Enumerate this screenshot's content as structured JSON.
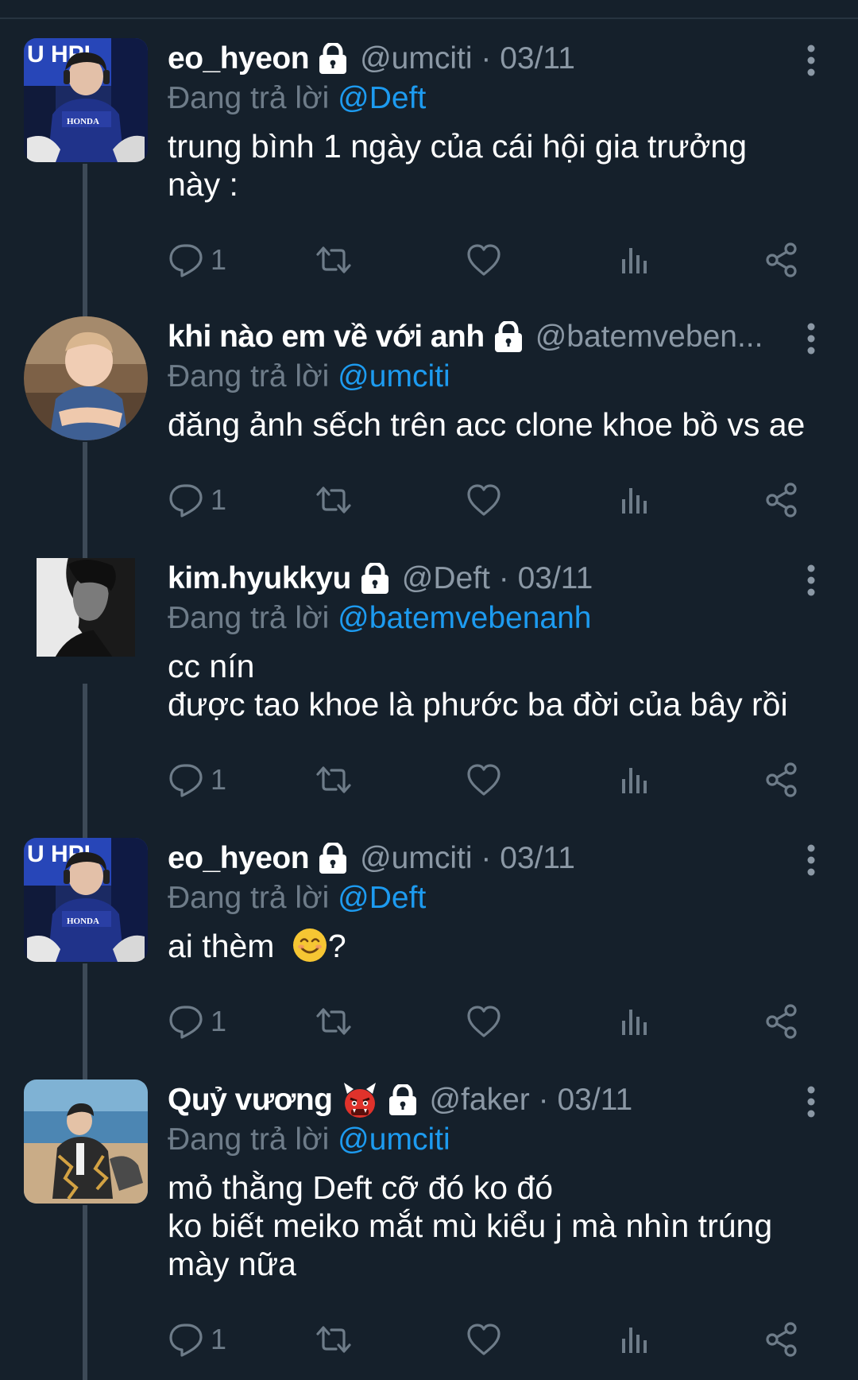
{
  "reply_prefix": "Đang trả lời",
  "tweets": [
    {
      "name": "eo_hyeon",
      "handle": "@umciti",
      "sep": "·",
      "date": "03/11",
      "reply_to": "@Deft",
      "lines": [
        "trung bình 1 ngày của cái hội gia trưởng",
        "này :"
      ],
      "reply_count": "1"
    },
    {
      "name": "khi nào em về với anh",
      "handle": "@batemveben...",
      "reply_to": "@umciti",
      "lines": [
        "đăng ảnh sếch trên acc clone khoe bồ vs ae"
      ],
      "reply_count": "1"
    },
    {
      "name": "kim.hyukkyu",
      "handle": "@Deft",
      "sep": "·",
      "date": "03/11",
      "reply_to": "@batemvebenanh",
      "lines": [
        "cc nín",
        "được tao khoe là phước ba đời của bây rồi"
      ],
      "reply_count": "1"
    },
    {
      "name": "eo_hyeon",
      "handle": "@umciti",
      "sep": "·",
      "date": "03/11",
      "reply_to": "@Deft",
      "line_prefix": "ai thèm ",
      "line_suffix": "?",
      "emoji": "smiling-face-emoji",
      "reply_count": "1"
    },
    {
      "name": "Quỷ vương",
      "name_emoji": "ogre-emoji",
      "handle": "@faker",
      "sep": "·",
      "date": "03/11",
      "reply_to": "@umciti",
      "lines": [
        "mỏ thằng Deft cỡ đó ko đó",
        "ko biết meiko mắt mù kiểu j mà nhìn trúng",
        "mày nữa"
      ],
      "reply_count": "1"
    }
  ],
  "colors": {
    "background": "#15202b",
    "secondary_text": "#8b98a5",
    "mention": "#1d9bf0",
    "thread_line": "#3d4a57"
  },
  "icons": [
    "lock-icon",
    "more-icon",
    "reply-icon",
    "retweet-icon",
    "like-icon",
    "views-icon",
    "share-icon"
  ]
}
